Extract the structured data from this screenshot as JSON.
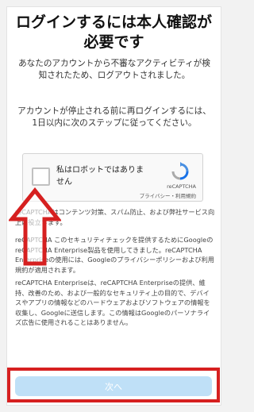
{
  "header": {
    "title_line1": "ログインするには本人確認が",
    "title_line2": "必要です"
  },
  "messages": {
    "logout_notice": "あなたのアカウントから不審なアクティビティが検知されたため、ログアウトされました。",
    "instruction": "アカウントが停止される前に再ログインするには、1日以内に次のステップに従ってください。"
  },
  "recaptcha": {
    "checkbox_label": "私はロボットではありません",
    "brand": "reCAPTCHA",
    "links": "プライバシー・利用規約",
    "logo_icon": "recaptcha-logo-icon"
  },
  "legal": {
    "p1": "reCAPTCHAはコンテンツ対策、スパム防止、および弊社サービス向上に役立ちます。",
    "p2": "reCAPTCHA このセキュリティチェックを提供するためにGoogleのreCAPTCHA Enterprise製品を使用してきました。reCAPTCHA Enterpriseの使用には、Googleのプライバシーポリシーおよび利用規約が適用されます。",
    "p3": "reCAPTCHA Enterpriseは、reCAPTCHA Enterpriseの提供、維持、改善のため、および一般的なセキュリティ上の目的で、デバイスやアプリの情報などのハードウェアおよびソフトウェアの情報を収集し、Googleに送信します。この情報はGoogleのパーソナライズ広告に使用されることはありません。"
  },
  "footer": {
    "next_label": "次へ"
  },
  "annotations": {
    "arrow_icon": "up-arrow-icon",
    "highlight_color": "#d62020"
  },
  "colors": {
    "button_disabled": "#bfe0f7",
    "background": "#f2f2f2"
  }
}
